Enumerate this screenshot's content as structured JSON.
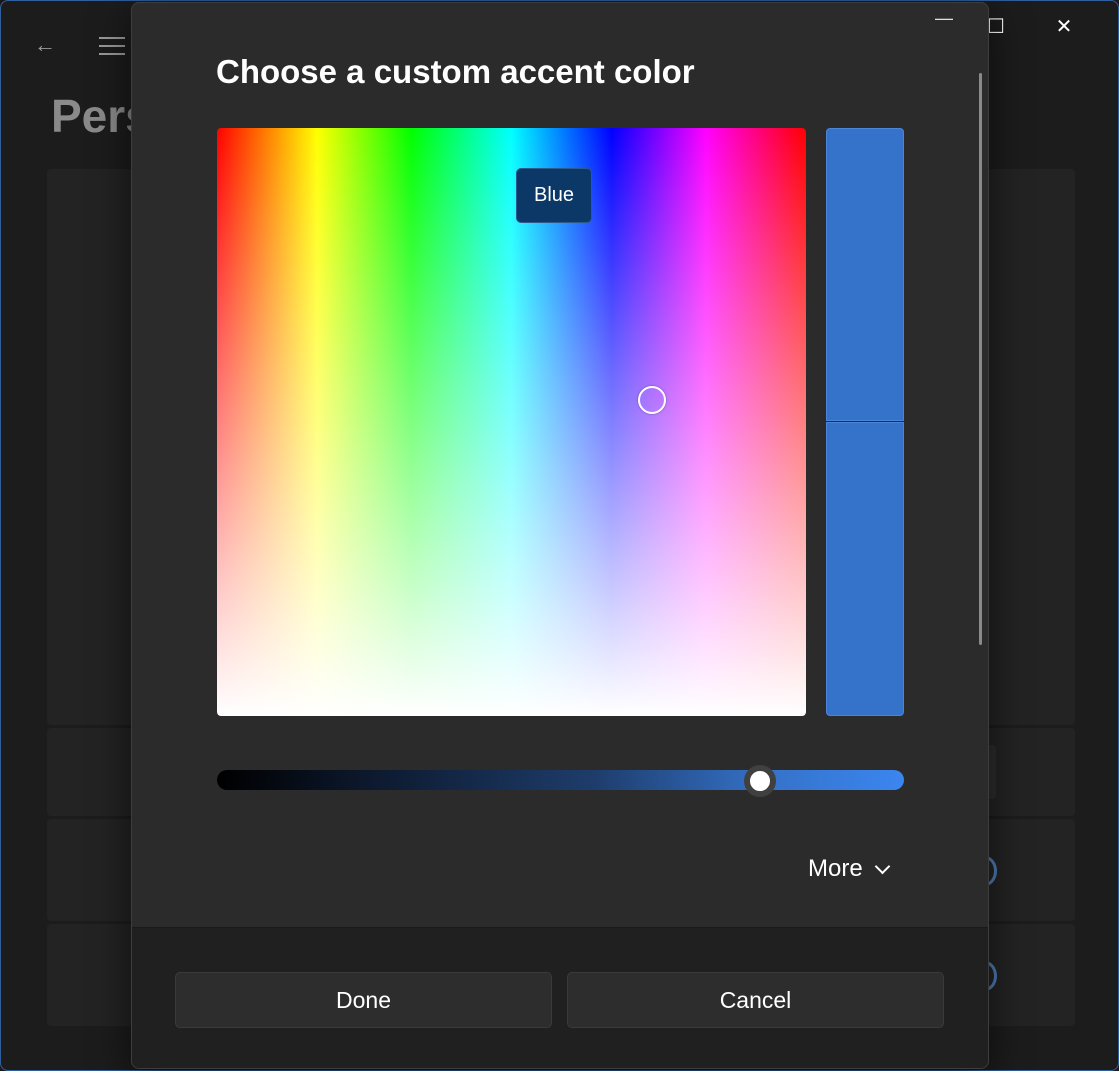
{
  "background_window": {
    "title": "Pers",
    "controls": {
      "minimize": "—",
      "maximize": "☐",
      "close": "✕"
    },
    "back_icon": "back-arrow-icon",
    "menu_icon": "hamburger-menu-icon"
  },
  "dialog": {
    "title": "Choose a custom accent color",
    "minimize_glyph": "—",
    "spectrum": {
      "tooltip": "Blue"
    },
    "selected_color": "#3572c9",
    "value_slider": {
      "value_fraction": 0.79
    },
    "more_label": "More",
    "done_label": "Done",
    "cancel_label": "Cancel"
  }
}
